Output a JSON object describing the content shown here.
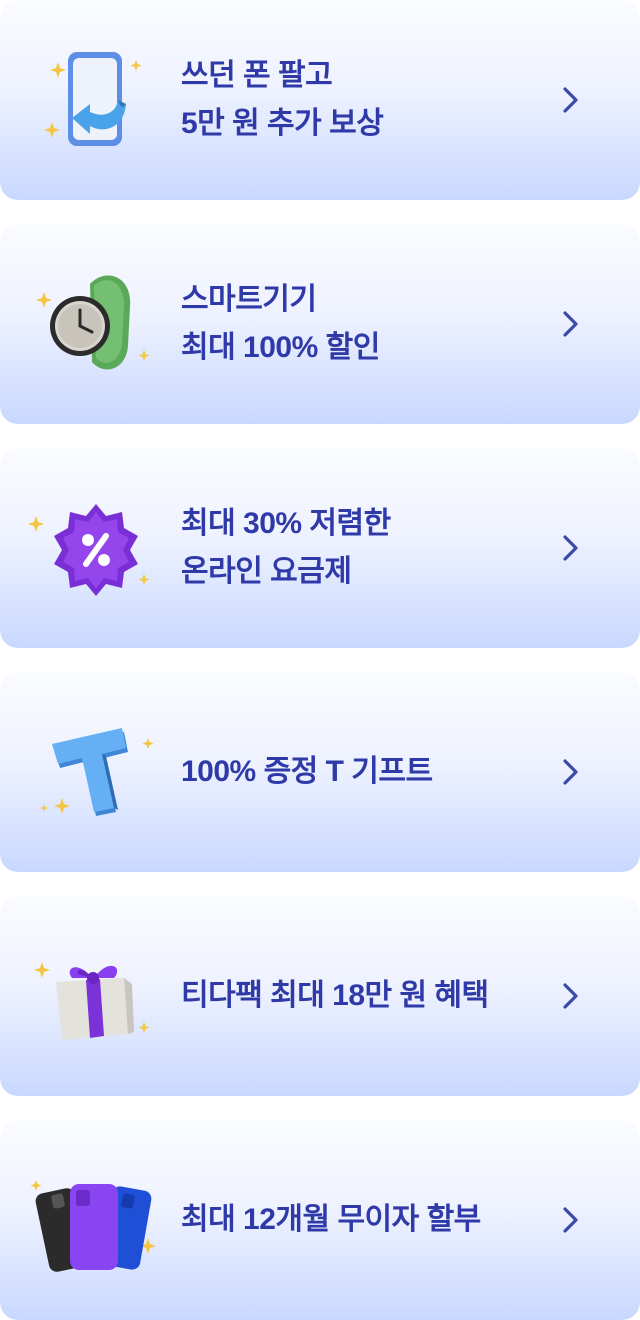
{
  "colors": {
    "text": "#2f3aa8",
    "card_top": "#fbfcff",
    "card_bottom": "#c9d8ff",
    "chevron": "#3a4aa6"
  },
  "cards": [
    {
      "icon": "phone-trade-in-icon",
      "lines": [
        "쓰던 폰 팔고",
        "5만 원 추가 보상"
      ]
    },
    {
      "icon": "smartwatch-icon",
      "lines": [
        "스마트기기",
        "최대 100% 할인"
      ]
    },
    {
      "icon": "percent-badge-icon",
      "lines": [
        "최대 30% 저렴한",
        "온라인 요금제"
      ]
    },
    {
      "icon": "t-letter-icon",
      "lines": [
        "100% 증정 T 기프트"
      ]
    },
    {
      "icon": "gift-box-icon",
      "lines": [
        "티다팩 최대 18만 원 혜택"
      ]
    },
    {
      "icon": "phone-cases-icon",
      "lines": [
        "최대 12개월 무이자 할부"
      ]
    }
  ]
}
